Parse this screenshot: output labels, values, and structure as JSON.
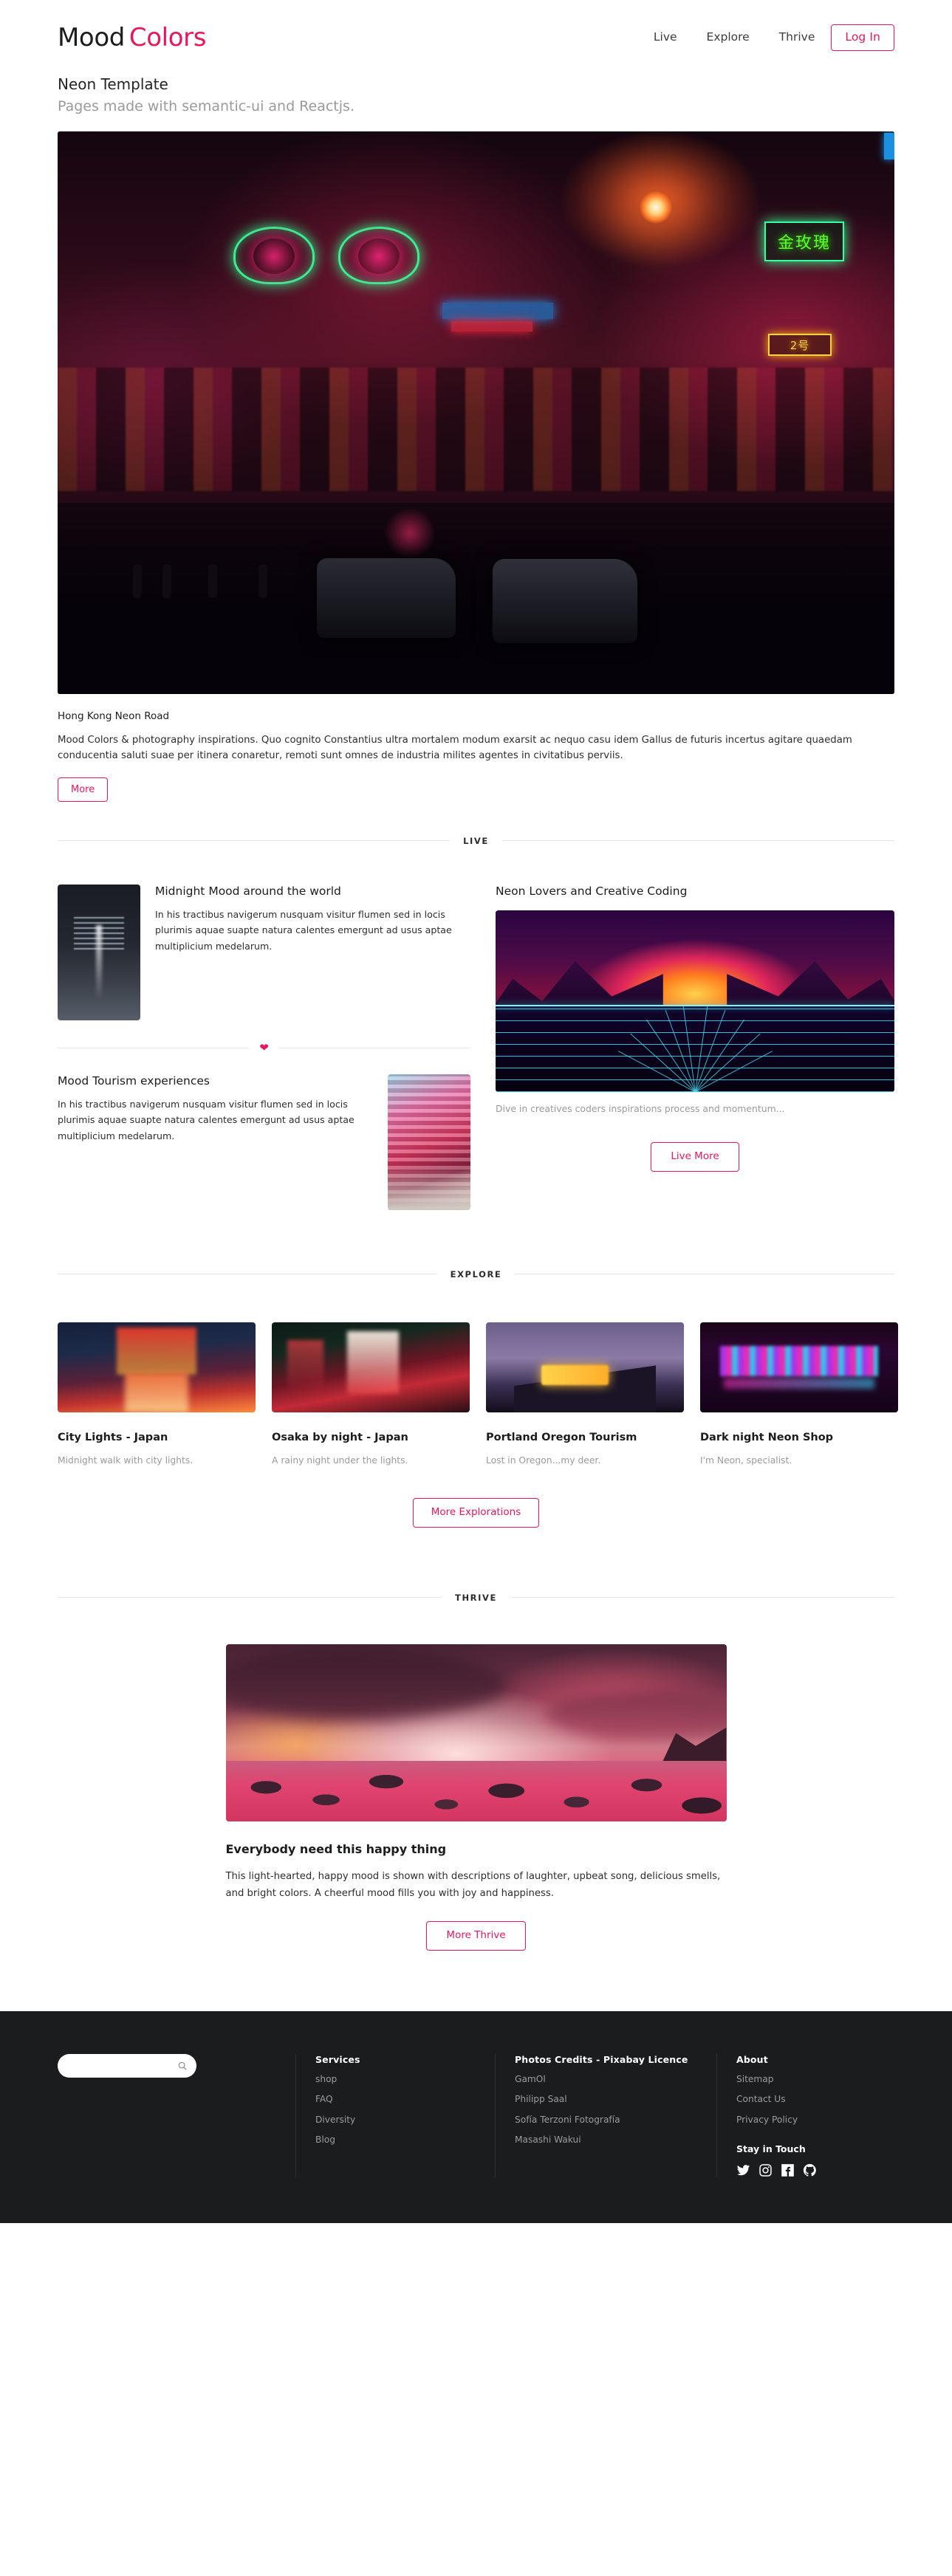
{
  "brand": {
    "first": "Mood",
    "second": "Colors",
    "accent": "#E8175D"
  },
  "nav": {
    "items": [
      {
        "label": "Live"
      },
      {
        "label": "Explore"
      },
      {
        "label": "Thrive"
      }
    ],
    "login_label": "Log In"
  },
  "hero": {
    "title": "Neon Template",
    "subtitle": "Pages made with semantic-ui and Reactjs.",
    "image_alt": "Hong Kong neon street at night with cars and glowing signs",
    "caption": "Hong Kong Neon Road",
    "body": "Mood Colors & photography inspirations. Quo cognito Constantius ultra mortalem modum exarsit ac nequo casu idem Gallus de futuris incertus agitare quaedam conducentia saluti suae per itinera conaretur, remoti sunt omnes de industria milites agentes in civitatibus perviis.",
    "more_label": "More",
    "sign_text": "金玫瑰",
    "sign_text2": "2号"
  },
  "live": {
    "divider_label": "LIVE",
    "items": [
      {
        "title": "Midnight Mood around the world",
        "text": "In his tractibus navigerum nusquam visitur flumen sed in locis plurimis aquae suapte natura calentes emergunt ad usus aptae multiplicium medelarum.",
        "image_alt": "Dark midnight city street with tram tracks"
      },
      {
        "title": "Mood Tourism experiences",
        "text": "In his tractibus navigerum nusquam visitur flumen sed in locis plurimis aquae suapte natura calentes emergunt ad usus aptae multiplicium medelarum.",
        "image_alt": "Colorful Osaka shopping street with billboards"
      }
    ],
    "feature": {
      "title": "Neon Lovers and Creative Coding",
      "caption": "Dive in creatives coders inspirations process and momentum...",
      "image_alt": "Retrowave neon sunset with cyan wireframe grid"
    },
    "button_label": "Live More"
  },
  "explore": {
    "divider_label": "EXPLORE",
    "cards": [
      {
        "title": "City Lights - Japan",
        "subtitle": "Midnight walk with city lights.",
        "image_alt": "Neon alley in Japan at night with reflections"
      },
      {
        "title": "Osaka by night - Japan",
        "subtitle": "A rainy night under the lights.",
        "image_alt": "Rainy Osaka street glowing red at night"
      },
      {
        "title": "Portland Oregon Tourism",
        "subtitle": "Lost in Oregon...my deer.",
        "image_alt": "Portland Oregon neon sign at dusk"
      },
      {
        "title": "Dark night Neon Shop",
        "subtitle": "I'm Neon, specialist.",
        "image_alt": "Purple neon shop front in the dark"
      }
    ],
    "button_label": "More Explorations"
  },
  "thrive": {
    "divider_label": "THRIVE",
    "image_alt": "Pink sunset over a rocky shoreline",
    "title": "Everybody need this happy thing",
    "text": "This light-hearted, happy mood is shown with descriptions of laughter, upbeat song, delicious smells, and bright colors. A cheerful mood fills you with joy and happiness.",
    "button_label": "More Thrive"
  },
  "footer": {
    "search_placeholder": "",
    "search_value": "",
    "columns": [
      {
        "heading": "Services",
        "links": [
          "shop",
          "FAQ",
          "Diversity",
          "Blog"
        ]
      },
      {
        "heading": "Photos Credits - Pixabay Licence",
        "links": [
          "GamOl",
          "Philipp Saal",
          "Sofía Terzoni Fotografía",
          "Masashi Wakui"
        ]
      },
      {
        "heading": "About",
        "links": [
          "Sitemap",
          "Contact Us",
          "Privacy Policy"
        ]
      }
    ],
    "stay_heading": "Stay in Touch",
    "socials": [
      "twitter-icon",
      "instagram-icon",
      "facebook-icon",
      "github-icon"
    ],
    "background": "#1B1C1D"
  }
}
